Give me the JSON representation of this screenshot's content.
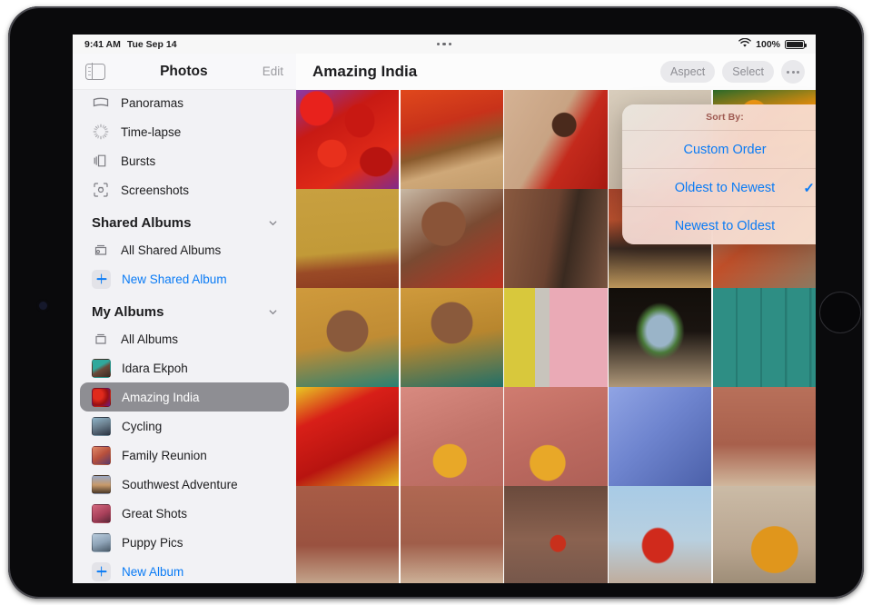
{
  "status_bar": {
    "time": "9:41 AM",
    "date": "Tue Sep 14",
    "wifi_icon": "wifi-icon",
    "battery_percent": "100%",
    "battery_icon": "battery-full-icon",
    "multitask_icon": "multitasking-dots-icon"
  },
  "sidebar": {
    "toggle_icon": "sidebar-toggle-icon",
    "title": "Photos",
    "edit_label": "Edit",
    "media_types": [
      {
        "label": "Panoramas",
        "icon": "panorama-icon"
      },
      {
        "label": "Time-lapse",
        "icon": "timelapse-icon"
      },
      {
        "label": "Bursts",
        "icon": "bursts-icon"
      },
      {
        "label": "Screenshots",
        "icon": "screenshot-icon"
      }
    ],
    "shared_section": {
      "title": "Shared Albums",
      "chevron_icon": "chevron-down-icon",
      "items": [
        {
          "label": "All Shared Albums",
          "icon": "shared-album-icon"
        },
        {
          "label": "New Shared Album",
          "icon": "plus-icon",
          "action": true
        }
      ]
    },
    "my_section": {
      "title": "My Albums",
      "chevron_icon": "chevron-down-icon",
      "items": [
        {
          "label": "All Albums",
          "icon": "album-stack-icon"
        },
        {
          "label": "Idara Ekpoh",
          "thumb": "#2c8f86"
        },
        {
          "label": "Amazing India",
          "thumb": "#a8232a",
          "selected": true
        },
        {
          "label": "Cycling",
          "thumb": "#4a5f77"
        },
        {
          "label": "Family Reunion",
          "thumb": "#c06a58"
        },
        {
          "label": "Southwest Adventure",
          "thumb": "#6f6a86"
        },
        {
          "label": "Great Shots",
          "thumb": "#b4566c"
        },
        {
          "label": "Puppy Pics",
          "thumb": "#8ea8c0"
        },
        {
          "label": "New Album",
          "icon": "plus-icon",
          "action": true
        }
      ]
    }
  },
  "content": {
    "title": "Amazing India",
    "aspect_label": "Aspect",
    "select_label": "Select",
    "more_icon": "more-ellipsis-icon"
  },
  "popover": {
    "header": "Sort By:",
    "options": [
      {
        "label": "Custom Order",
        "checked": false
      },
      {
        "label": "Oldest to Newest",
        "checked": true
      },
      {
        "label": "Newest to Oldest",
        "checked": false
      }
    ],
    "check_glyph": "✓",
    "accent_color": "#0a7bf5"
  },
  "photo_grid": {
    "columns": 5,
    "photos": [
      {
        "name": "red-chili-peppers",
        "c1": "#c21a18",
        "c2": "#7b2a9c"
      },
      {
        "name": "sari-feet-sandals",
        "c1": "#d23a22",
        "c2": "#c99a6e"
      },
      {
        "name": "woman-red-blouse-wall",
        "c1": "#c8a083",
        "c2": "#b8281e"
      },
      {
        "name": "hidden-behind-popover-a",
        "c1": "#cbbfae",
        "c2": "#b9a894"
      },
      {
        "name": "oranges-market-stall",
        "c1": "#e08a1c",
        "c2": "#7a3a12"
      },
      {
        "name": "blue-man-yellow-wall",
        "c1": "#c49a3c",
        "c2": "#a8502c"
      },
      {
        "name": "curly-hair-portrait",
        "c1": "#8a4a36",
        "c2": "#c0392b"
      },
      {
        "name": "two-faces-close-up",
        "c1": "#7b4f3a",
        "c2": "#3a2a22"
      },
      {
        "name": "striped-dress-woman",
        "c1": "#b8452c",
        "c2": "#3b2a24"
      },
      {
        "name": "man-orange-shirt-wall",
        "c1": "#c2512a",
        "c2": "#8a7a64"
      },
      {
        "name": "headwrap-portrait-a",
        "c1": "#c7923a",
        "c2": "#1f7d7a"
      },
      {
        "name": "headwrap-hands-portrait",
        "c1": "#c7923a",
        "c2": "#1a6f6e"
      },
      {
        "name": "yellow-door-pink-wall",
        "c1": "#d3c23c",
        "c2": "#e8a8b6"
      },
      {
        "name": "archway-woman-red",
        "c1": "#1b1410",
        "c2": "#b9a383"
      },
      {
        "name": "teal-weathered-door",
        "c1": "#2e8e84",
        "c2": "#1d6b63"
      },
      {
        "name": "red-fabric-pile",
        "c1": "#d81f1a",
        "c2": "#e8c324"
      },
      {
        "name": "fabric-drying-worker-a",
        "c1": "#d88a80",
        "c2": "#e8a430"
      },
      {
        "name": "fabric-drying-worker-b",
        "c1": "#d07c70",
        "c2": "#e0a028"
      },
      {
        "name": "blue-city-building",
        "c1": "#7b8fd6",
        "c2": "#4a5fa8"
      },
      {
        "name": "humayun-tomb-facade",
        "c1": "#b06a52",
        "c2": "#d8c3a8"
      },
      {
        "name": "red-fort-courtyard",
        "c1": "#a85c46",
        "c2": "#c9b096"
      },
      {
        "name": "mughal-arch-woman",
        "c1": "#b06852",
        "c2": "#d2bca2"
      },
      {
        "name": "stone-staircase-red-dress",
        "c1": "#8a5a48",
        "c2": "#6a4a3c"
      },
      {
        "name": "woman-red-sari-sky",
        "c1": "#9ec4e0",
        "c2": "#c0392b"
      },
      {
        "name": "woman-yellow-top-tomb",
        "c1": "#b8a590",
        "c2": "#d8921c"
      }
    ]
  }
}
